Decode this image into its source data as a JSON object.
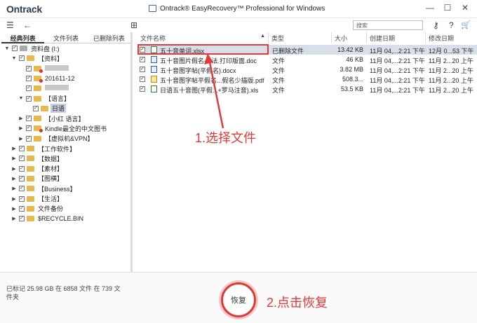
{
  "app": {
    "logo": "Ontrack",
    "title": "Ontrack® EasyRecovery™ Professional for Windows",
    "window_controls": [
      "—",
      "☐",
      "✕"
    ]
  },
  "toolbar": {
    "menu_glyph": "☰",
    "back_glyph": "←",
    "view_glyph": "⊞",
    "search_placeholder": "搜索",
    "key_glyph": "⚷",
    "help_glyph": "?",
    "cart_glyph": "🛒"
  },
  "tabs": [
    "经典列表",
    "文件列表",
    "已删除列表"
  ],
  "tree": [
    {
      "label": "资料盘 (I:)",
      "exp": "▼",
      "cb": "☑",
      "icon": "hd"
    },
    {
      "label": "【资料】",
      "exp": "▼",
      "cb": "☑",
      "icon": "folder"
    },
    {
      "label": "",
      "exp": "",
      "cb": "☑",
      "icon": "red",
      "blur": true
    },
    {
      "label": "201611-12",
      "exp": "",
      "cb": "☑",
      "icon": "red"
    },
    {
      "label": "",
      "exp": "",
      "cb": "☑",
      "icon": "folder",
      "blur": true
    },
    {
      "label": "【语言】",
      "exp": "▼",
      "cb": "☑",
      "icon": "folder"
    },
    {
      "label": "日语",
      "exp": "",
      "cb": "☑",
      "icon": "folder",
      "selected": true
    },
    {
      "label": "【小红 语言】",
      "exp": "▶",
      "cb": "☑",
      "icon": "folder"
    },
    {
      "label": "Kindle最全的中文图书",
      "exp": "▶",
      "cb": "☑",
      "icon": "red"
    },
    {
      "label": "【虚拟机&VPN】",
      "exp": "▶",
      "cb": "☑",
      "icon": "folder"
    },
    {
      "label": "【工作软件】",
      "exp": "▶",
      "cb": "☑",
      "icon": "folder"
    },
    {
      "label": "【数据】",
      "exp": "▶",
      "cb": "☑",
      "icon": "folder"
    },
    {
      "label": "【素材】",
      "exp": "▶",
      "cb": "☑",
      "icon": "folder"
    },
    {
      "label": "【图横】",
      "exp": "▶",
      "cb": "☑",
      "icon": "folder"
    },
    {
      "label": "【Business】",
      "exp": "▶",
      "cb": "☑",
      "icon": "folder"
    },
    {
      "label": "【生活】",
      "exp": "▶",
      "cb": "☑",
      "icon": "folder"
    },
    {
      "label": "文件备份",
      "exp": "▶",
      "cb": "☑",
      "icon": "folder"
    },
    {
      "label": "$RECYCLE.BIN",
      "exp": "▶",
      "cb": "☑",
      "icon": "folder"
    }
  ],
  "columns": {
    "name": "文件名称",
    "sort_glyph": "▲",
    "type": "类型",
    "size": "大小",
    "created": "创建日期",
    "modified": "修改日期"
  },
  "files": [
    {
      "name": "五十音单词.xlsx",
      "type": "已删除文件",
      "size": "13.42 KB",
      "created": "11月 04,...2:21 下午",
      "modified": "12月 0...53 下午",
      "icon": "x",
      "selected": true
    },
    {
      "name": "五十音图片假名-...法.打印版面.doc",
      "type": "文件",
      "size": "46 KB",
      "created": "11月 04,...2:21 下午",
      "modified": "11月 2...20 上午",
      "icon": "w"
    },
    {
      "name": "五十音图字帖(平假名).docx",
      "type": "文件",
      "size": "3.82 MB",
      "created": "11月 04,...2:21 下午",
      "modified": "11月 2...20 上午",
      "icon": "w"
    },
    {
      "name": "五十音图字帖平假名...假名少描版.pdf",
      "type": "文件",
      "size": "508.3...",
      "created": "11月 04,...2:21 下午",
      "modified": "11月 2...20 上午",
      "icon": "p"
    },
    {
      "name": "日语五十音图(平假...+罗马注音).xls",
      "type": "文件",
      "size": "53.5 KB",
      "created": "11月 04,...2:21 下午",
      "modified": "11月 2...20 上午",
      "icon": "x"
    }
  ],
  "status_text": "已标记 25.98 GB 在 6858 文件 在 739 文件夹",
  "restore_label": "恢复",
  "annotation_1": "1.选择文件",
  "annotation_2": "2.点击恢复",
  "annotation_color": "#e53935"
}
